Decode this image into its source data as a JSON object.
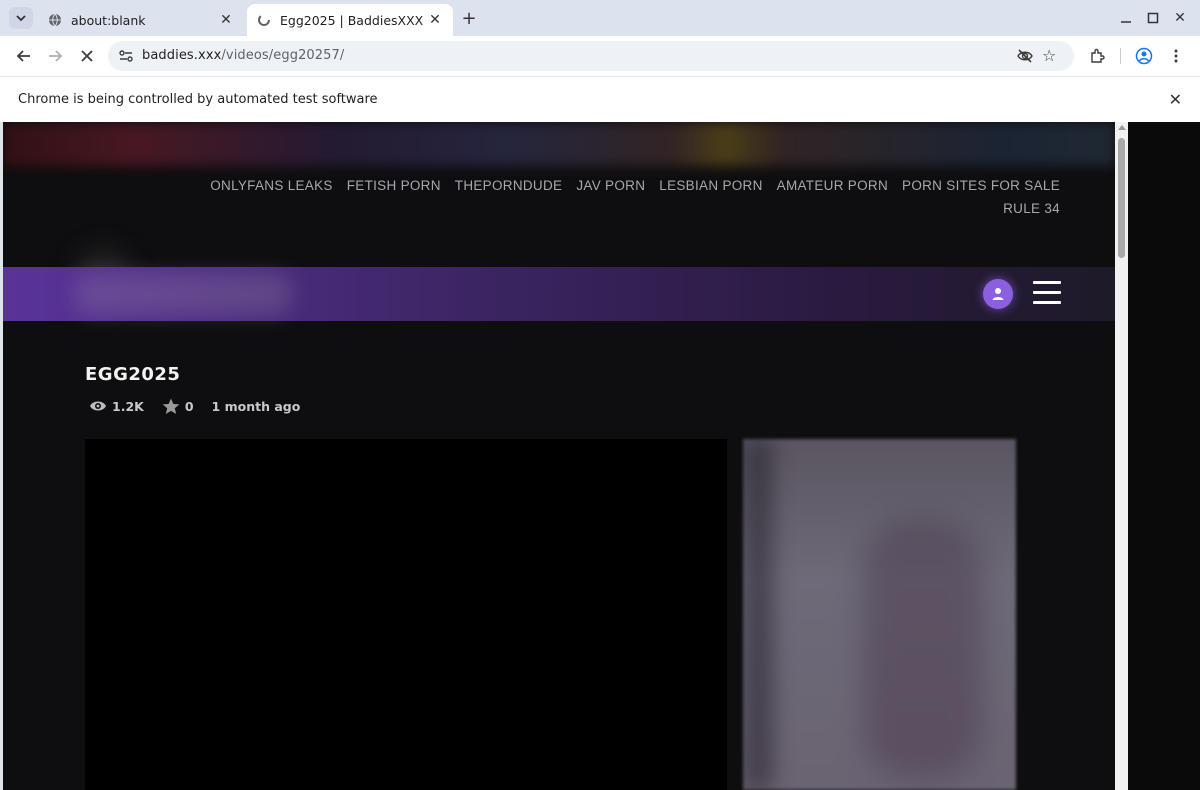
{
  "browser": {
    "tabs": [
      {
        "title": "about:blank",
        "active": false
      },
      {
        "title": "Egg2025 | BaddiesXXX",
        "active": true
      }
    ],
    "address": {
      "domain": "baddies.xxx",
      "path": "/videos/egg20257/"
    },
    "infobar": {
      "message": "Chrome is being controlled by automated test software"
    }
  },
  "site": {
    "nav_links": [
      "ONLYFANS LEAKS",
      "FETISH PORN",
      "THEPORNDUDE",
      "JAV PORN",
      "LESBIAN PORN",
      "AMATEUR PORN",
      "PORN SITES FOR SALE",
      "RULE 34"
    ],
    "video": {
      "title": "EGG2025",
      "views": "1.2K",
      "rating": "0",
      "posted": "1 month ago"
    },
    "accent_color": "#8a5fe0"
  }
}
